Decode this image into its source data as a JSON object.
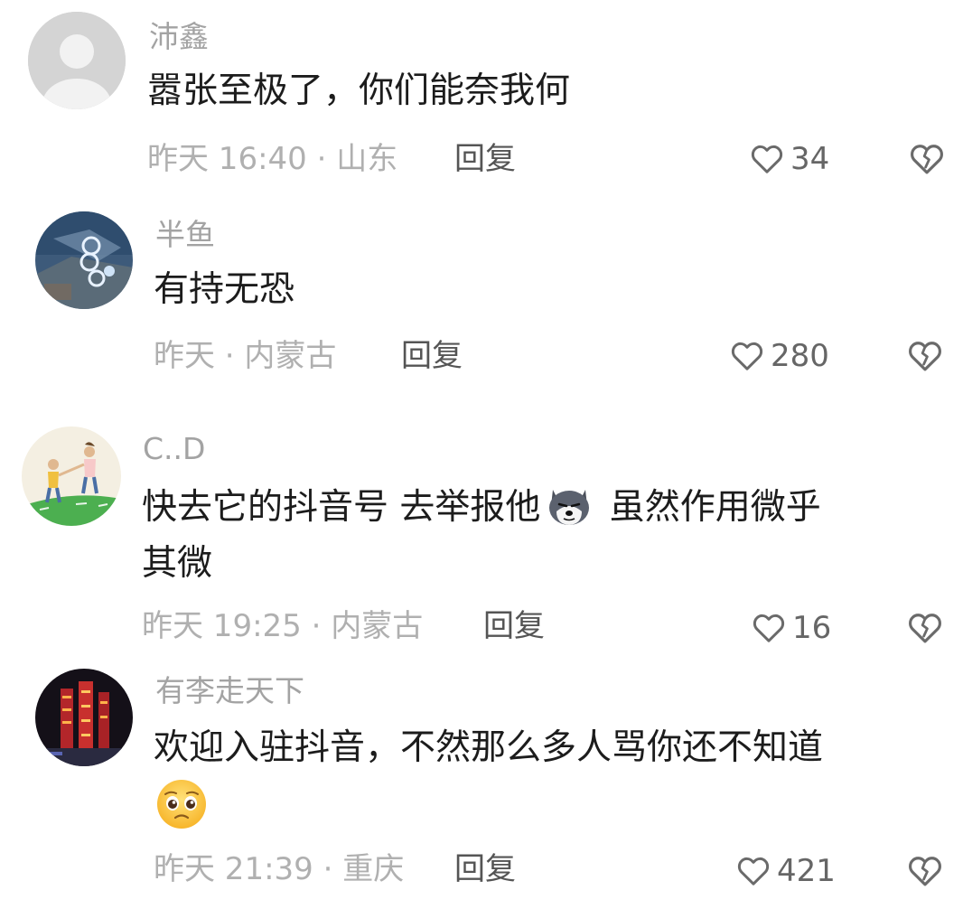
{
  "comments": [
    {
      "username": "沛鑫",
      "text": "嚣张至极了，你们能奈我何",
      "meta": "昨天 16:40 · 山东",
      "reply": "回复",
      "likes": "34"
    },
    {
      "username": "半鱼",
      "text": "有持无恐",
      "meta": "昨天 · 内蒙古",
      "reply": "回复",
      "likes": "280"
    },
    {
      "username": "C..D",
      "text_a": "快去它的抖音号  去举报他",
      "text_b": "  虽然作用微乎",
      "text_line2": "其微",
      "meta": "昨天 19:25 · 内蒙古",
      "reply": "回复",
      "likes": "16"
    },
    {
      "username": "有李走天下",
      "text": "欢迎入驻抖音，不然那么多人骂你还不知道",
      "meta": "昨天 21:39 · 重庆",
      "reply": "回复",
      "likes": "421"
    }
  ],
  "icons": {
    "like": "heart-outline-icon",
    "dislike": "broken-heart-icon",
    "emoji_1": "husky-dog-emoji",
    "emoji_2": "pleading-face-emoji"
  },
  "colors": {
    "username": "#a3a3a3",
    "meta": "#b0b0b0",
    "reply": "#555555",
    "text": "#1c1c1c"
  }
}
